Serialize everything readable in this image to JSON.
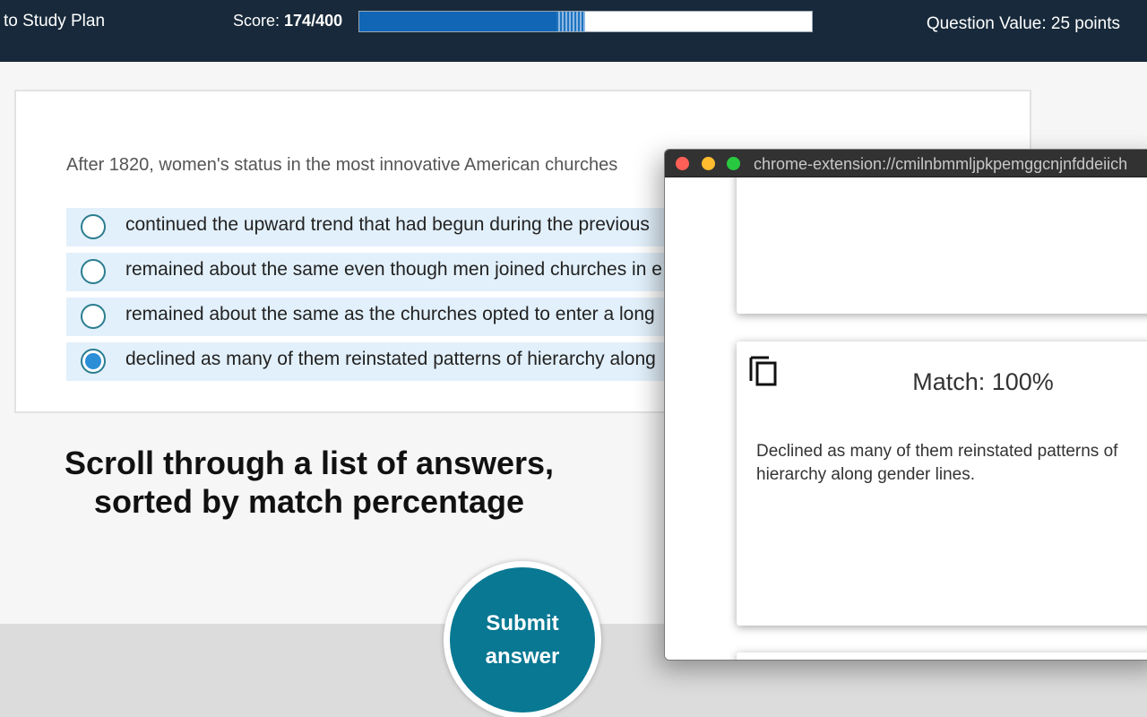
{
  "header": {
    "back_link": "to Study Plan",
    "score_label": "Score: ",
    "score_value": "174/400",
    "question_value": "Question Value: 25 points",
    "progress_fraction": 0.435,
    "pending_fraction": 0.0625
  },
  "question": {
    "text": "After 1820, women's status in the most innovative American churches",
    "options": [
      {
        "label": "continued the upward trend that had begun during the previous",
        "checked": false
      },
      {
        "label": "remained about the same even though men joined churches in e",
        "checked": false
      },
      {
        "label": "remained about the same as the churches opted to enter a long",
        "checked": false
      },
      {
        "label": "declined as many of them reinstated patterns of hierarchy along",
        "checked": true
      }
    ]
  },
  "promo": {
    "line1": "Scroll through a list of answers,",
    "line2": "sorted by match percentage"
  },
  "submit": {
    "label": "Submit answer"
  },
  "extension": {
    "url": "chrome-extension://cmilnbmmljpkpemggcnjnfddeiich",
    "results": [
      {
        "match": "Match: 100%",
        "answer": "Declined as many of them reinstated patterns of hierarchy along gender lines."
      }
    ]
  },
  "colors": {
    "header_bg": "#17293a",
    "progress_fill": "#1166b6",
    "option_bg": "#e2f0fb",
    "submit_bg": "#087893"
  }
}
